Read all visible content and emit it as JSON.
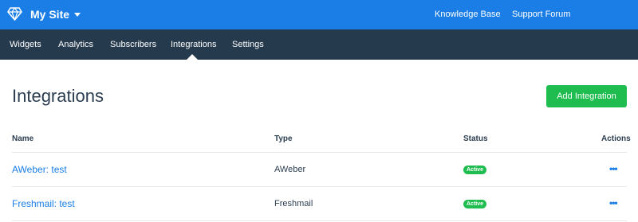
{
  "topbar": {
    "logo_icon": "diamond-logo-icon",
    "site_name": "My Site",
    "site_dropdown_icon": "caret-down-icon",
    "links": [
      "Knowledge Base",
      "Support Forum"
    ]
  },
  "nav": {
    "items": [
      "Widgets",
      "Analytics",
      "Subscribers",
      "Integrations",
      "Settings"
    ],
    "active": "Integrations"
  },
  "page": {
    "title": "Integrations",
    "add_button": "Add Integration"
  },
  "table": {
    "headers": {
      "name": "Name",
      "type": "Type",
      "status": "Status",
      "actions": "Actions"
    },
    "rows": [
      {
        "name": "AWeber: test",
        "type": "AWeber",
        "status": "Active",
        "actions_icon": "more-horizontal-icon"
      },
      {
        "name": "Freshmail: test",
        "type": "Freshmail",
        "status": "Active",
        "actions_icon": "more-horizontal-icon"
      }
    ]
  },
  "colors": {
    "topbar": "#1a7ee6",
    "navbar": "#263a4d",
    "success": "#1fbd4f",
    "link": "#1a7ee6",
    "text": "#2c3e50"
  }
}
